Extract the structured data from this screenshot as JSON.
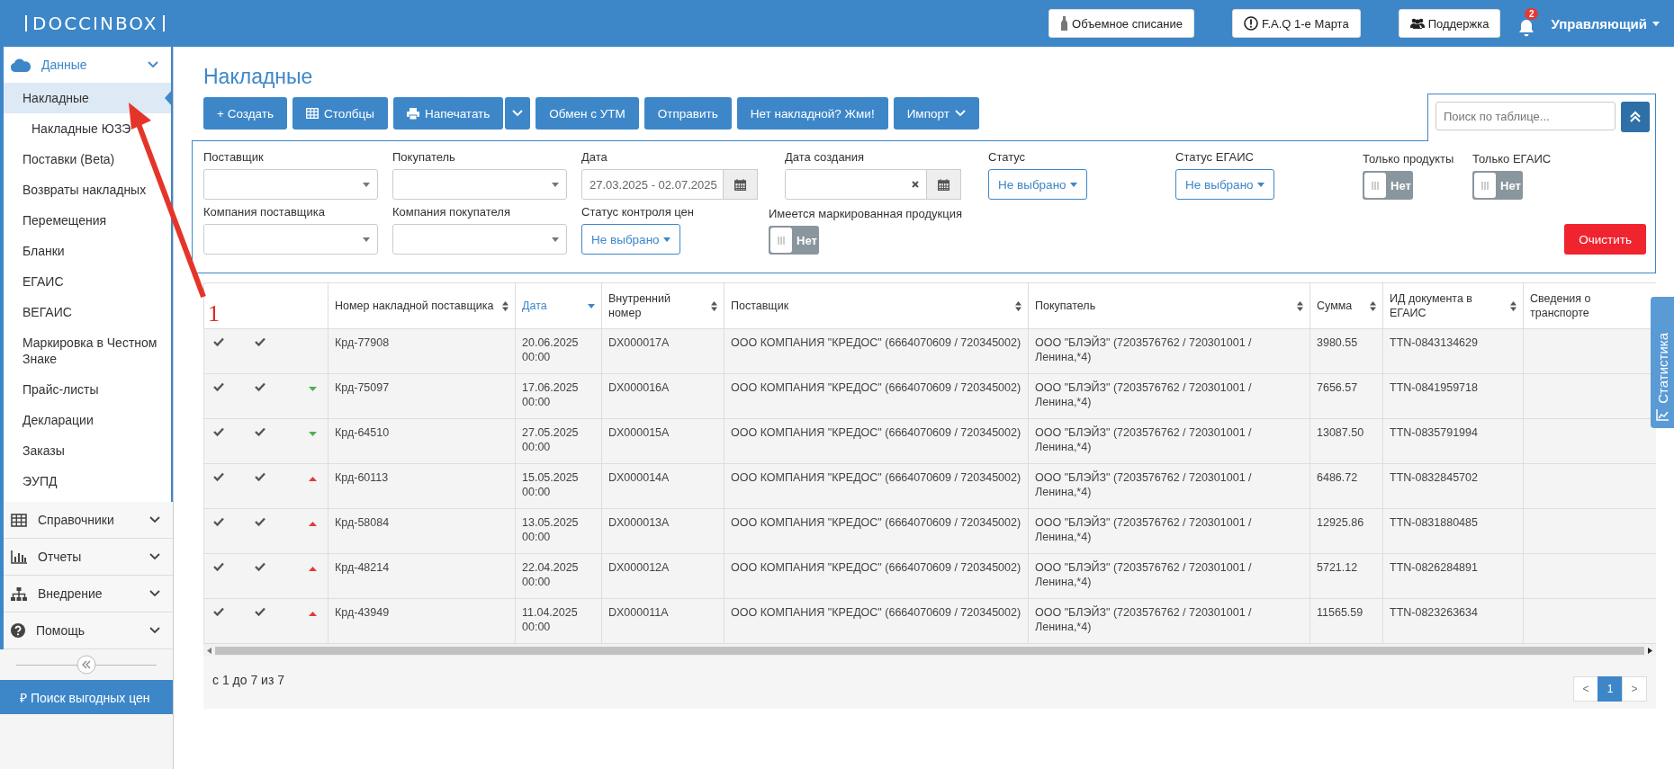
{
  "header": {
    "logo": "DOCCINBOX",
    "buttons": [
      {
        "label": "Объемное списание"
      },
      {
        "label": "F.A.Q 1-е Марта"
      },
      {
        "label": "Поддержка"
      }
    ],
    "notifications": "2",
    "user": "Управляющий"
  },
  "sidebar": {
    "sections": [
      {
        "label": "Данные",
        "expanded": true,
        "items": [
          {
            "label": "Накладные",
            "selected": true,
            "children": [
              {
                "label": "Накладные ЮЗЭ",
                "selected": false
              }
            ]
          },
          {
            "label": "Поставки (Beta)",
            "selected": false
          },
          {
            "label": "Возвраты накладных",
            "selected": false
          },
          {
            "label": "Перемещения",
            "selected": false
          },
          {
            "label": "Бланки",
            "selected": false
          },
          {
            "label": "ЕГАИС",
            "selected": false
          },
          {
            "label": "ВЕГАИС",
            "selected": false
          },
          {
            "label": "Маркировка в Честном Знаке",
            "selected": false
          },
          {
            "label": "Прайс-листы",
            "selected": false
          },
          {
            "label": "Декларации",
            "selected": false
          },
          {
            "label": "Заказы",
            "selected": false
          },
          {
            "label": "ЭУПД",
            "selected": false
          }
        ]
      },
      {
        "label": "Справочники",
        "expanded": false
      },
      {
        "label": "Отчеты",
        "expanded": false
      },
      {
        "label": "Внедрение",
        "expanded": false
      },
      {
        "label": "Помощь",
        "expanded": false
      }
    ],
    "promo": {
      "symbol": "₽",
      "label": "Поиск выгодных цен"
    }
  },
  "page_title": "Накладные",
  "toolbar": [
    {
      "kind": "button",
      "label": "+ Создать"
    },
    {
      "kind": "button",
      "label": "Столбцы"
    },
    {
      "kind": "split",
      "label": "Напечатать"
    },
    {
      "kind": "button",
      "label": "Обмен с УТМ"
    },
    {
      "kind": "button",
      "label": "Отправить"
    },
    {
      "kind": "button",
      "label": "Нет накладной? Жми!"
    },
    {
      "kind": "dropdown",
      "label": "Импорт"
    }
  ],
  "search": {
    "placeholder": "Поиск по таблице..."
  },
  "filter_rows": [
    {
      "filters": [
        {
          "kind": "select",
          "label": "Поставщик"
        },
        {
          "kind": "select",
          "label": "Покупатель"
        },
        {
          "kind": "daterange",
          "label": "Дата",
          "value": "27.03.2025 - 02.07.2025"
        },
        {
          "kind": "daterange",
          "label": "Дата создания"
        },
        {
          "kind": "dropdown",
          "label": "Статус",
          "value": "Не выбрано"
        },
        {
          "kind": "dropdown",
          "label": "Статус ЕГАИС",
          "value": "Не выбрано"
        },
        {
          "kind": "toggle",
          "label": "Только продукты",
          "value": "Нет",
          "on": false
        },
        {
          "kind": "toggle",
          "label": "Только ЕГАИС",
          "value": "Нет",
          "on": false
        }
      ]
    },
    {
      "filters": [
        {
          "kind": "select",
          "label": "Компания поставщика"
        },
        {
          "kind": "select",
          "label": "Компания покупателя"
        },
        {
          "kind": "dropdown",
          "label": "Статус контроля цен",
          "value": "Не выбрано"
        },
        {
          "kind": "toggle",
          "label": "Имеется маркированная продукция",
          "value": "Нет",
          "on": false
        }
      ]
    }
  ],
  "clear_button": "Очистить",
  "annotation": "1",
  "table": {
    "columns": [
      {
        "label": "Номер накладной поставщика",
        "sortable": true,
        "sorted": false
      },
      {
        "label": "Дата",
        "sortable": true,
        "sorted": true
      },
      {
        "label": "Внутренний номер",
        "sortable": true,
        "sorted": false
      },
      {
        "label": "Поставщик",
        "sortable": true,
        "sorted": false
      },
      {
        "label": "Покупатель",
        "sortable": true,
        "sorted": false
      },
      {
        "label": "Сумма",
        "sortable": true,
        "sorted": false
      },
      {
        "label": "ИД документа в ЕГАИС",
        "sortable": true,
        "sorted": false
      },
      {
        "label": "Сведения о транспорте",
        "sortable": false,
        "sorted": false
      }
    ],
    "rows": [
      {
        "column_1_checked": true,
        "column_2_checked": true,
        "increased": false,
        "decreased": false,
        "number": "Крд-77908",
        "date": "20.06.2025 00:00",
        "internal": "DX000017A",
        "supplier": "ООО КОМПАНИЯ \"КРЕДОС\" (6664070609 / 720345002)",
        "buyer": "ООО \"БЛЭЙЗ\" (7203576762 / 720301001 / Ленина,*4)",
        "sum": "3980.55",
        "egais_id": "TTN-0843134629"
      },
      {
        "column_1_checked": true,
        "column_2_checked": true,
        "increased": false,
        "decreased": true,
        "number": "Крд-75097",
        "date": "17.06.2025 00:00",
        "internal": "DX000016A",
        "supplier": "ООО КОМПАНИЯ \"КРЕДОС\" (6664070609 / 720345002)",
        "buyer": "ООО \"БЛЭЙЗ\" (7203576762 / 720301001 / Ленина,*4)",
        "sum": "7656.57",
        "egais_id": "TTN-0841959718"
      },
      {
        "column_1_checked": true,
        "column_2_checked": true,
        "increased": false,
        "decreased": true,
        "number": "Крд-64510",
        "date": "27.05.2025 00:00",
        "internal": "DX000015A",
        "supplier": "ООО КОМПАНИЯ \"КРЕДОС\" (6664070609 / 720345002)",
        "buyer": "ООО \"БЛЭЙЗ\" (7203576762 / 720301001 / Ленина,*4)",
        "sum": "13087.50",
        "egais_id": "TTN-0835791994"
      },
      {
        "column_1_checked": true,
        "column_2_checked": true,
        "increased": true,
        "decreased": false,
        "number": "Крд-60113",
        "date": "15.05.2025 00:00",
        "internal": "DX000014A",
        "supplier": "ООО КОМПАНИЯ \"КРЕДОС\" (6664070609 / 720345002)",
        "buyer": "ООО \"БЛЭЙЗ\" (7203576762 / 720301001 / Ленина,*4)",
        "sum": "6486.72",
        "egais_id": "TTN-0832845702"
      },
      {
        "column_1_checked": true,
        "column_2_checked": true,
        "increased": true,
        "decreased": false,
        "number": "Крд-58084",
        "date": "13.05.2025 00:00",
        "internal": "DX000013A",
        "supplier": "ООО КОМПАНИЯ \"КРЕДОС\" (6664070609 / 720345002)",
        "buyer": "ООО \"БЛЭЙЗ\" (7203576762 / 720301001 / Ленина,*4)",
        "sum": "12925.86",
        "egais_id": "TTN-0831880485"
      },
      {
        "column_1_checked": true,
        "column_2_checked": true,
        "increased": true,
        "decreased": false,
        "number": "Крд-48214",
        "date": "22.04.2025 00:00",
        "internal": "DX000012A",
        "supplier": "ООО КОМПАНИЯ \"КРЕДОС\" (6664070609 / 720345002)",
        "buyer": "ООО \"БЛЭЙЗ\" (7203576762 / 720301001 / Ленина,*4)",
        "sum": "5721.12",
        "egais_id": "TTN-0826284891"
      },
      {
        "column_1_checked": true,
        "column_2_checked": true,
        "increased": true,
        "decreased": false,
        "number": "Крд-43949",
        "date": "11.04.2025 00:00",
        "internal": "DX000011A",
        "supplier": "ООО КОМПАНИЯ \"КРЕДОС\" (6664070609 / 720345002)",
        "buyer": "ООО \"БЛЭЙЗ\" (7203576762 / 720301001 / Ленина,*4)",
        "sum": "11565.59",
        "egais_id": "TTN-0823263634"
      }
    ]
  },
  "footer": {
    "range": "с 1 до 7 из 7",
    "pages": [
      {
        "label": "<",
        "selected": false
      },
      {
        "label": "1",
        "selected": true
      },
      {
        "label": ">",
        "selected": false
      }
    ]
  },
  "stats_tab": "Статистика"
}
